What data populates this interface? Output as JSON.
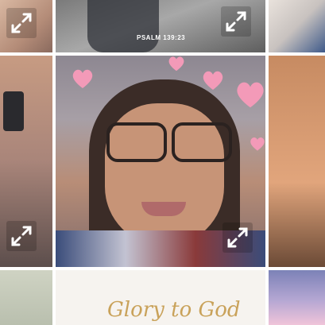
{
  "gallery": {
    "tiles": [
      {
        "id": "top-left",
        "has_expand": true
      },
      {
        "id": "top-center",
        "caption": "PSALM 139:23",
        "has_expand": true
      },
      {
        "id": "top-right"
      },
      {
        "id": "mid-left",
        "has_expand": true
      },
      {
        "id": "mid-center",
        "has_expand": true
      },
      {
        "id": "mid-right"
      },
      {
        "id": "bottom-left"
      },
      {
        "id": "bottom-center",
        "script_text": "Glory to God"
      },
      {
        "id": "bottom-right"
      }
    ],
    "expand_icon": "expand-arrows-icon"
  },
  "colors": {
    "gap": "#ffffff",
    "script_gold": "#c9a25a",
    "heart_pink": "#f39ab8"
  }
}
